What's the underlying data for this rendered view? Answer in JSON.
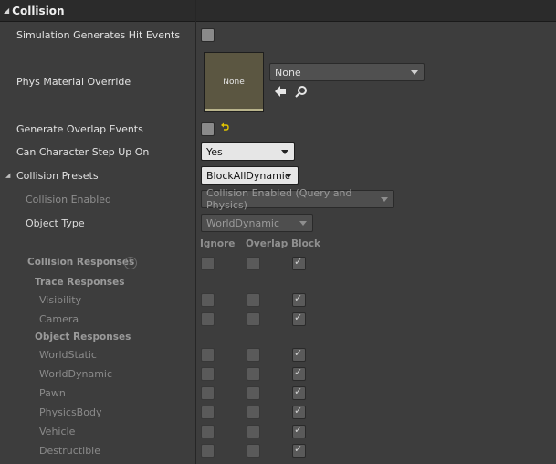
{
  "section": {
    "title": "Collision",
    "expand_glyph": "◢"
  },
  "rows": {
    "sim_hit_events": "Simulation Generates Hit Events",
    "phys_material": "Phys Material Override",
    "overlap_events": "Generate Overlap Events",
    "step_up": "Can Character Step Up On",
    "presets": "Collision Presets",
    "collision_enabled": "Collision Enabled",
    "object_type": "Object Type"
  },
  "phys_material": {
    "thumb_label": "None",
    "dropdown_value": "None",
    "use_icon": "arrow-left-icon",
    "browse_icon": "magnifier-icon"
  },
  "overlap_reset_icon": "reset-arrow-icon",
  "step_up_value": "Yes",
  "presets_value": "BlockAllDynamic",
  "collision_enabled_value": "Collision Enabled (Query and Physics)",
  "object_type_value": "WorldDynamic",
  "columns": {
    "ignore": "Ignore",
    "overlap": "Overlap",
    "block": "Block"
  },
  "responses": {
    "title": "Collision Responses",
    "help": "?",
    "trace_title": "Trace Responses",
    "trace": [
      "Visibility",
      "Camera"
    ],
    "object_title": "Object Responses",
    "object": [
      "WorldStatic",
      "WorldDynamic",
      "Pawn",
      "PhysicsBody",
      "Vehicle",
      "Destructible"
    ]
  }
}
